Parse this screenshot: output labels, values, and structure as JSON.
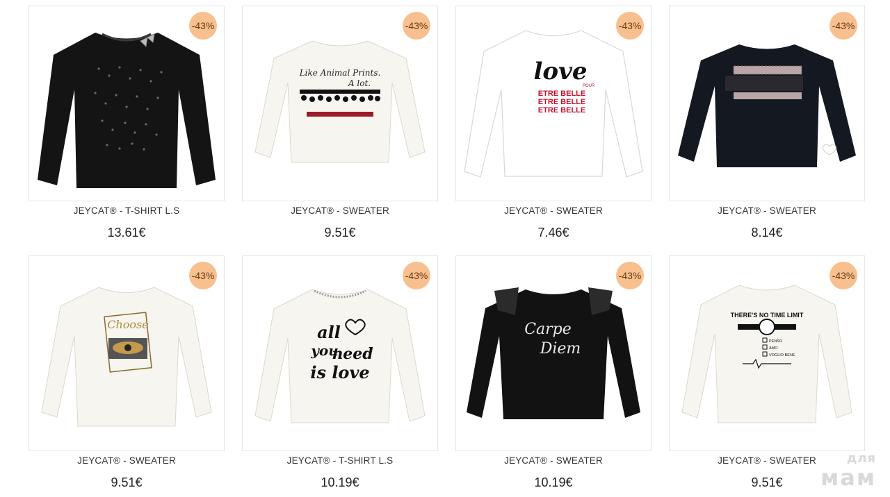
{
  "products": [
    {
      "name": "JEYCAT® - T-SHIRT L.S",
      "price": "13.61€",
      "badge": "-43%",
      "garment_color": "#141414",
      "graphic": "sequins"
    },
    {
      "name": "JEYCAT® - SWEATER",
      "price": "9.51€",
      "badge": "-43%",
      "garment_color": "#f7f5ef",
      "graphic": "pompom"
    },
    {
      "name": "JEYCAT® - SWEATER",
      "price": "7.46€",
      "badge": "-43%",
      "garment_color": "#ffffff",
      "graphic": "love"
    },
    {
      "name": "JEYCAT® - SWEATER",
      "price": "8.14€",
      "badge": "-43%",
      "garment_color": "#141820",
      "graphic": "ruffle"
    },
    {
      "name": "JEYCAT® - SWEATER",
      "price": "9.51€",
      "badge": "-43%",
      "garment_color": "#f7f5ef",
      "graphic": "eye"
    },
    {
      "name": "JEYCAT® - T-SHIRT L.S",
      "price": "10.19€",
      "badge": "-43%",
      "garment_color": "#f7f5ef",
      "graphic": "all-you-need"
    },
    {
      "name": "JEYCAT® - SWEATER",
      "price": "10.19€",
      "badge": "-43%",
      "garment_color": "#121212",
      "graphic": "carpe-diem"
    },
    {
      "name": "JEYCAT® - SWEATER",
      "price": "9.51€",
      "badge": "-43%",
      "garment_color": "#f7f5ef",
      "graphic": "time-limit"
    }
  ],
  "prints": {
    "animal_line1": "Like Animal Prints.",
    "animal_line2": "A lot.",
    "love_word": "love",
    "pour": "POUR",
    "etre_belle": "ETRE BELLE",
    "choose": "Choose",
    "all": "all",
    "you": "you",
    "need": "need",
    "is_love": "is love",
    "carpe": "Carpe",
    "diem": "Diem",
    "time_limit": "THERE'S NO TIME LIMIT",
    "penso": "PENSO",
    "amo": "AMO",
    "voglio_bene": "VOGLIO BENE"
  },
  "colors": {
    "badge_bg": "#f8c08f",
    "badge_text": "#6a3a12",
    "card_border": "#e6e6e6",
    "belle_red": "#c8102e"
  },
  "watermark": {
    "line1": "для",
    "line2": "мам"
  }
}
